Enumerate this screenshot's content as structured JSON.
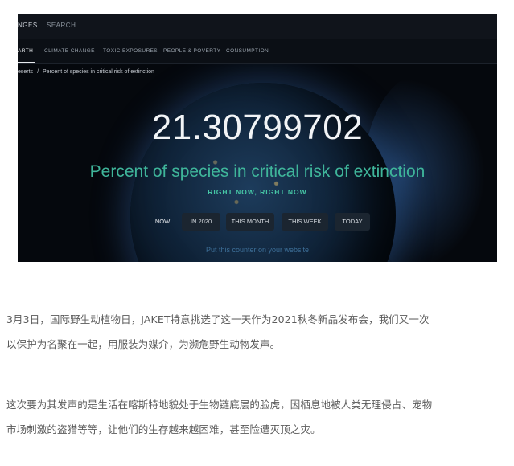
{
  "screenshot": {
    "nav": {
      "item1": "NGES",
      "item2": "SEARCH"
    },
    "subnav": [
      "ARTH",
      "CLIMATE CHANGE",
      "TOXIC EXPOSURES",
      "PEOPLE & POVERTY",
      "CONSUMPTION"
    ],
    "breadcrumb": {
      "parent": "eserts",
      "separator": "/",
      "current": "Percent of species in critical risk of extinction"
    },
    "counter_value": "21.30799702",
    "subtitle": "Percent of species in critical risk of extinction",
    "tagline": "RIGHT NOW, RIGHT NOW",
    "time_buttons": [
      "NOW",
      "IN 2020",
      "THIS MONTH",
      "THIS WEEK",
      "TODAY"
    ],
    "embed_link": "Put this counter on your website"
  },
  "article": {
    "paragraph1_line1": "3月3日，国际野生动植物日，JAKET特意挑选了这一天作为2021秋冬新品发布会，我们又一次",
    "paragraph1_line2": "以保护为名聚在一起，用服装为媒介，为濒危野生动物发声。",
    "paragraph2_line1": "这次要为其发声的是生活在喀斯特地貌处于生物链底层的脸虎，因栖息地被人类无理侵占、宠物",
    "paragraph2_line2": "市场刺激的盗猎等等，让他们的生存越来越困难，甚至险遭灭顶之灾。"
  },
  "colors": {
    "accent_green": "#3fb59a",
    "link_blue": "#3d6f98",
    "body_text": "#5b5b5b"
  }
}
